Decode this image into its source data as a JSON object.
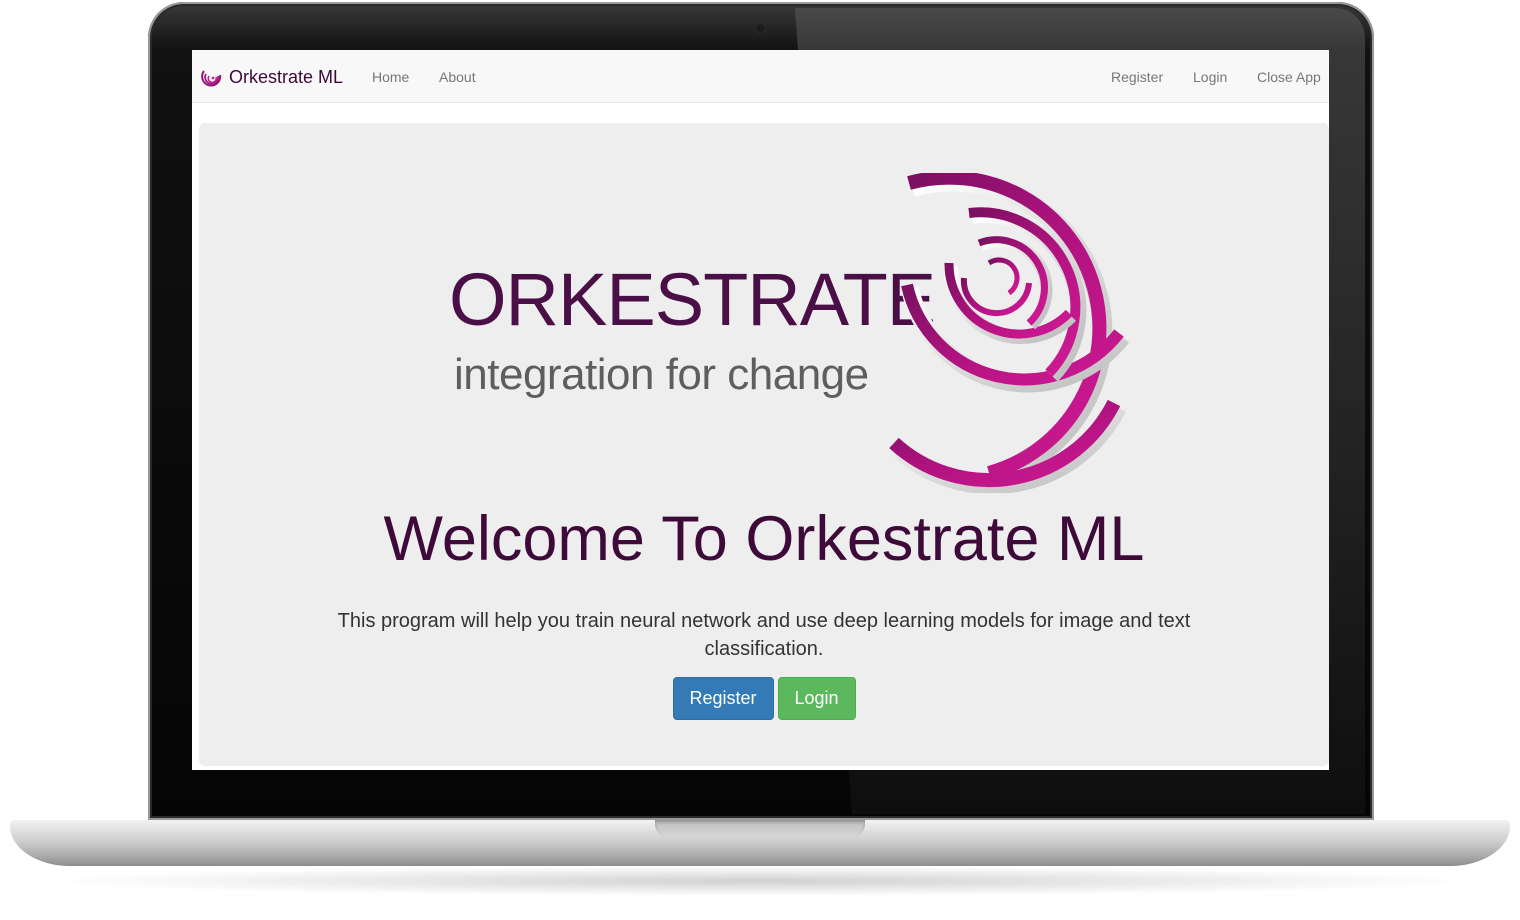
{
  "navbar": {
    "brand": "Orkestrate ML",
    "left_links": [
      "Home",
      "About"
    ],
    "right_links": [
      "Register",
      "Login",
      "Close App"
    ]
  },
  "logo": {
    "wordmark": "ORKESTRATE",
    "tagline": "integration for change"
  },
  "hero": {
    "title": "Welcome To Orkestrate ML",
    "description": "This program will help you train neural network and use deep learning models for image and text classification.",
    "register_button": "Register",
    "login_button": "Login"
  },
  "colors": {
    "brand_purple": "#3d0a3a",
    "swirl_magenta": "#b0127f",
    "primary_button": "#337ab7",
    "success_button": "#5cb85c"
  }
}
